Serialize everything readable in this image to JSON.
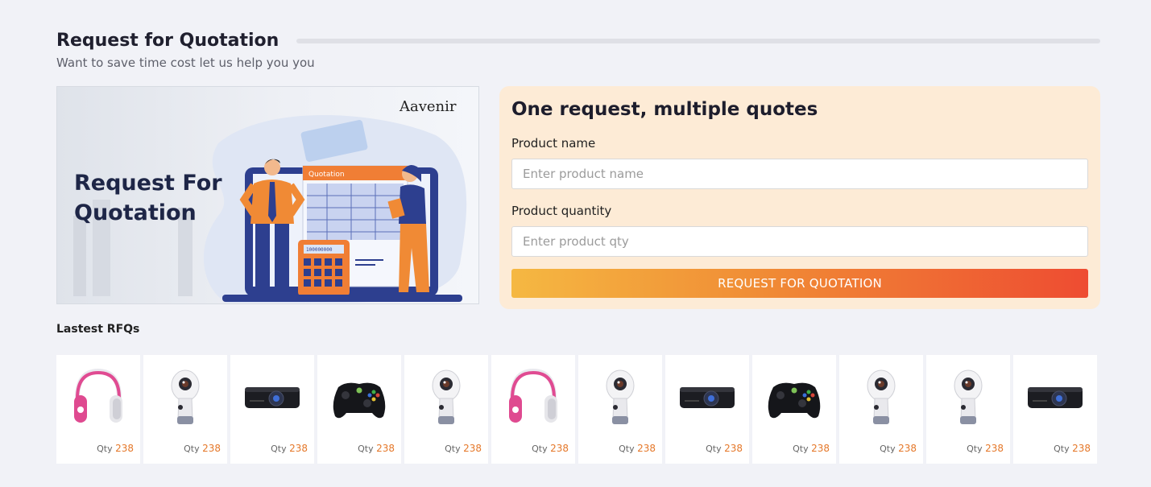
{
  "header": {
    "title": "Request for Quotation",
    "subtitle": "Want to save time cost let us help you you"
  },
  "banner": {
    "heading_line1": "Request For",
    "heading_line2": "Quotation",
    "brand": "Aavenir",
    "doc_label": "Quotation",
    "calc_display": "100000000"
  },
  "form": {
    "title": "One request, multiple quotes",
    "product_name_label": "Product name",
    "product_name_placeholder": "Enter product name",
    "product_qty_label": "Product quantity",
    "product_qty_placeholder": "Enter product qty",
    "submit_label": "REQUEST FOR QUOTATION"
  },
  "latest": {
    "label": "Lastest RFQs",
    "qty_label": "Qty",
    "items": [
      {
        "product": "headphones-pink",
        "qty": "238"
      },
      {
        "product": "camera-360",
        "qty": "238"
      },
      {
        "product": "projector",
        "qty": "238"
      },
      {
        "product": "gamepad",
        "qty": "238"
      },
      {
        "product": "camera-360",
        "qty": "238"
      },
      {
        "product": "headphones-pink",
        "qty": "238"
      },
      {
        "product": "camera-360",
        "qty": "238"
      },
      {
        "product": "projector",
        "qty": "238"
      },
      {
        "product": "gamepad",
        "qty": "238"
      },
      {
        "product": "camera-360",
        "qty": "238"
      },
      {
        "product": "camera-360",
        "qty": "238"
      },
      {
        "product": "projector",
        "qty": "238"
      }
    ]
  },
  "colors": {
    "accent_orange": "#e5782a",
    "cta_start": "#f5b842",
    "cta_end": "#ee4c32",
    "card_bg": "#fdebd6"
  }
}
